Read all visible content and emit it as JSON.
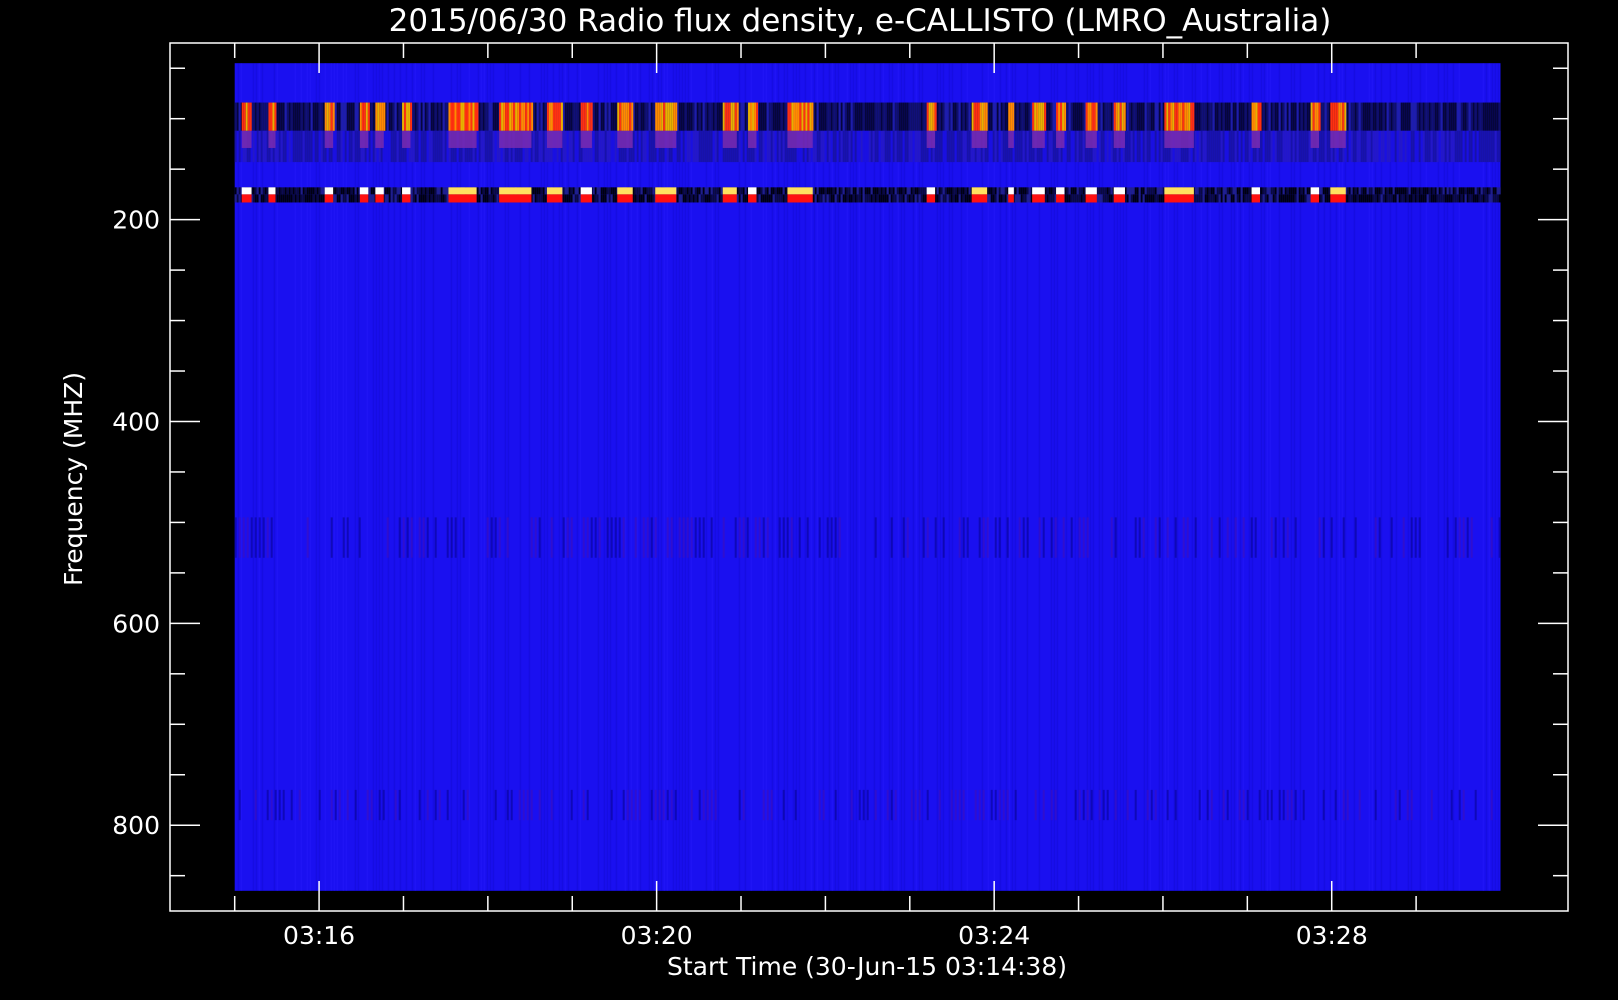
{
  "chart_data": {
    "type": "heatmap",
    "title": "2015/06/30  Radio flux density, e-CALLISTO (LMRO_Australia)",
    "xlabel": "Start Time (30-Jun-15 03:14:38)",
    "ylabel": "Frequency (MHZ)",
    "x_tick_labels": [
      "03:16",
      "03:20",
      "03:24",
      "03:28"
    ],
    "x_ticks_seconds": [
      82,
      322,
      562,
      802
    ],
    "x_minor_ticks_seconds": [
      22,
      142,
      202,
      262,
      382,
      442,
      502,
      622,
      682,
      742,
      862
    ],
    "x_range_seconds": [
      -24,
      970
    ],
    "data_time_range_seconds": [
      22,
      922
    ],
    "y_tick_labels": [
      "200",
      "400",
      "600",
      "800"
    ],
    "y_ticks": [
      200,
      400,
      600,
      800
    ],
    "y_minor_ticks": [
      50,
      100,
      150,
      250,
      300,
      350,
      450,
      500,
      550,
      650,
      700,
      750,
      850
    ],
    "y_range": [
      25,
      885
    ],
    "y_inverted": true,
    "data_freq_range": [
      45,
      865
    ],
    "background_color": "#1a10f0",
    "interference_bands_mhz": {
      "band1": [
        84,
        112
      ],
      "band2": [
        112,
        143
      ],
      "band3": [
        168,
        175
      ],
      "band4": [
        175,
        183
      ]
    },
    "burst_events_seconds": [
      [
        27,
        34
      ],
      [
        46,
        51
      ],
      [
        86,
        92
      ],
      [
        111,
        117
      ],
      [
        122,
        128
      ],
      [
        141,
        147
      ],
      [
        174,
        194
      ],
      [
        210,
        233
      ],
      [
        244,
        255
      ],
      [
        268,
        276
      ],
      [
        294,
        305
      ],
      [
        321,
        336
      ],
      [
        369,
        379
      ],
      [
        387,
        393
      ],
      [
        415,
        433
      ],
      [
        514,
        520
      ],
      [
        546,
        557
      ],
      [
        572,
        576
      ],
      [
        589,
        598
      ],
      [
        606,
        612
      ],
      [
        627,
        635
      ],
      [
        647,
        655
      ],
      [
        683,
        704
      ],
      [
        745,
        751
      ],
      [
        787,
        793
      ],
      [
        801,
        812
      ]
    ],
    "faint_bands_mhz": [
      [
        495,
        535
      ],
      [
        765,
        795
      ]
    ]
  }
}
